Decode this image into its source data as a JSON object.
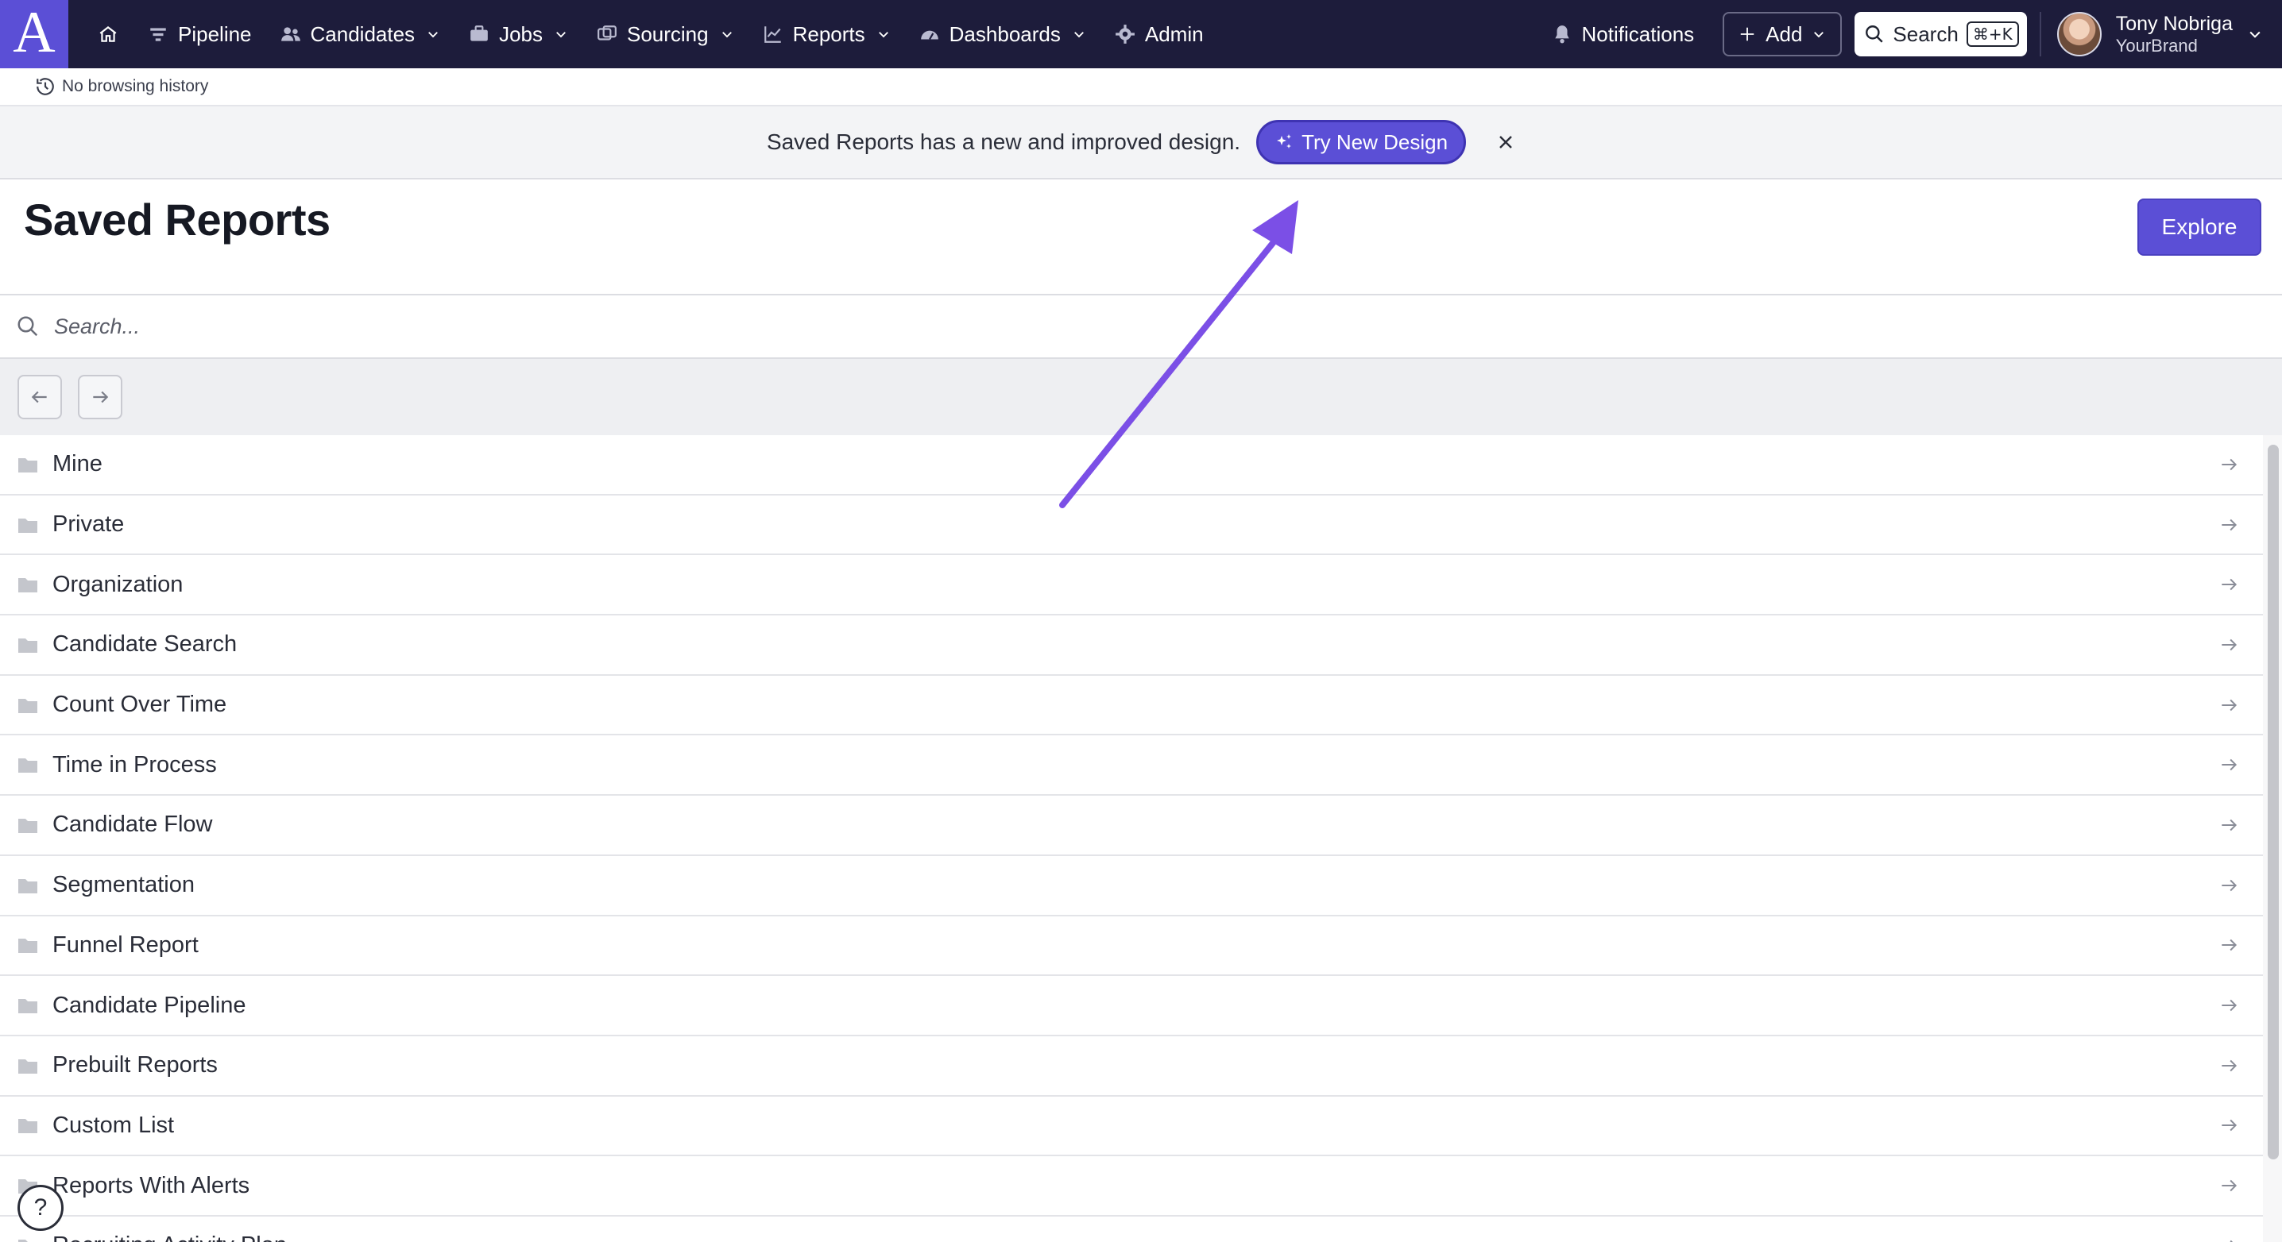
{
  "nav": {
    "logo": "A",
    "items": [
      {
        "label": "Pipeline",
        "icon": "filter-icon"
      },
      {
        "label": "Candidates",
        "icon": "users-icon"
      },
      {
        "label": "Jobs",
        "icon": "briefcase-icon"
      },
      {
        "label": "Sourcing",
        "icon": "sourcing-icon"
      },
      {
        "label": "Reports",
        "icon": "chart-icon"
      },
      {
        "label": "Dashboards",
        "icon": "gauge-icon"
      },
      {
        "label": "Admin",
        "icon": "gear-icon"
      }
    ],
    "notifications": "Notifications",
    "add": "Add",
    "search": "Search",
    "search_shortcut": "⌘+K",
    "user_name": "Tony Nobriga",
    "user_brand": "YourBrand"
  },
  "history": {
    "text": "No browsing history"
  },
  "banner": {
    "text": "Saved Reports has a new and improved design.",
    "button": "Try New Design"
  },
  "page": {
    "title": "Saved Reports",
    "explore": "Explore",
    "search_placeholder": "Search..."
  },
  "folders": [
    "Mine",
    "Private",
    "Organization",
    "Candidate Search",
    "Count Over Time",
    "Time in Process",
    "Candidate Flow",
    "Segmentation",
    "Funnel Report",
    "Candidate Pipeline",
    "Prebuilt Reports",
    "Custom List",
    "Reports With Alerts",
    "Recruiting Activity Plan"
  ],
  "help": "?",
  "colors": {
    "nav_bg": "#1d1c3b",
    "accent": "#5b4fd6",
    "annotation_arrow": "#7b4fe6"
  }
}
